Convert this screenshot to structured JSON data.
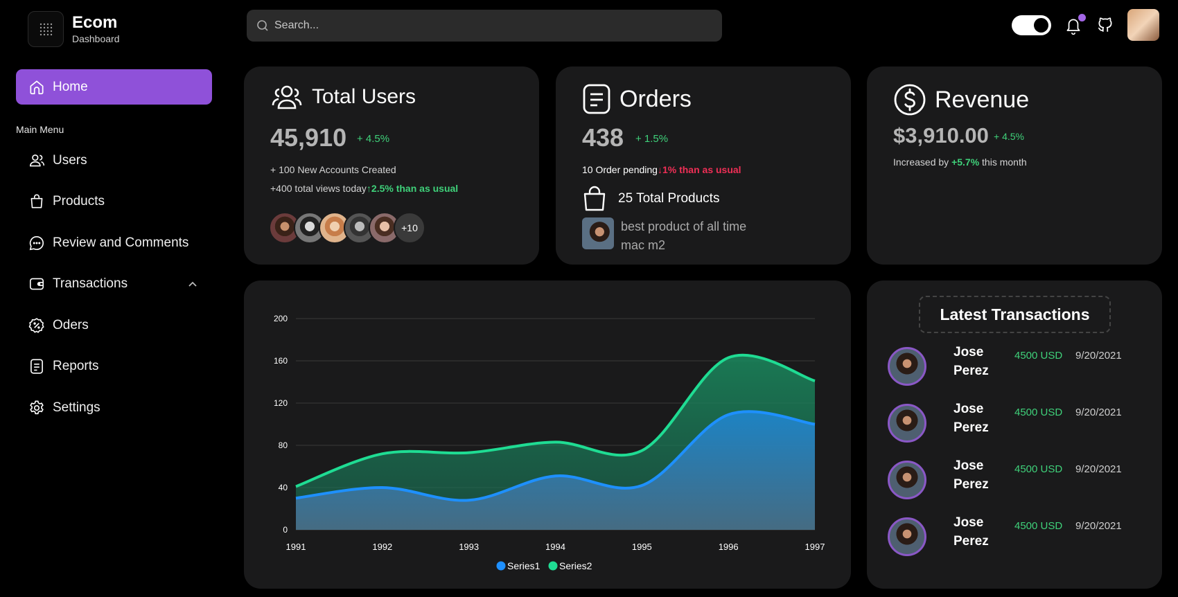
{
  "brand": {
    "title": "Ecom",
    "subtitle": "Dashboard"
  },
  "sidebar": {
    "home_label": "Home",
    "menu_label": "Main Menu",
    "items": [
      {
        "label": "Users",
        "icon": "users-icon"
      },
      {
        "label": "Products",
        "icon": "bag-icon"
      },
      {
        "label": "Review and Comments",
        "icon": "chat-icon"
      },
      {
        "label": "Transactions",
        "icon": "wallet-icon"
      },
      {
        "label": "Oders",
        "icon": "discount-badge-icon"
      },
      {
        "label": "Reports",
        "icon": "report-icon"
      },
      {
        "label": "Settings",
        "icon": "gear-icon"
      }
    ]
  },
  "header": {
    "search_placeholder": "Search...",
    "theme_toggle": "on"
  },
  "cards": {
    "users": {
      "title": "Total Users",
      "value": "45,910",
      "change": "+ 4.5%",
      "line1": "+ 100 New Accounts Created",
      "line2_prefix": "+400 total views today",
      "line2_highlight": "2.5% than as usual",
      "avatars_more": "+10"
    },
    "orders": {
      "title": "Orders",
      "value": "438",
      "change": "+ 1.5%",
      "pending_prefix": "10 Order pending",
      "pending_highlight": "1% than as usual",
      "products_label": "25 Total Products",
      "product_desc": "best product of all time mac m2"
    },
    "revenue": {
      "title": "Revenue",
      "value": "$3,910.00",
      "change": "+ 4.5%",
      "note_prefix": "Increased by",
      "note_highlight": "+5.7%",
      "note_suffix": "this month"
    }
  },
  "chart_data": {
    "type": "area",
    "x": [
      "1991",
      "1992",
      "1993",
      "1994",
      "1995",
      "1996",
      "1997"
    ],
    "series": [
      {
        "name": "Series1",
        "values": [
          30,
          40,
          28,
          51,
          42,
          109,
          100
        ],
        "color": "#1e90ff"
      },
      {
        "name": "Series2",
        "values": [
          41,
          72,
          73,
          83,
          75,
          163,
          141
        ],
        "color": "#1fdc93"
      }
    ],
    "yticks": [
      0,
      40,
      80,
      120,
      160,
      200
    ],
    "ylim": [
      0,
      200
    ],
    "legend": "bottom-center",
    "grid": true
  },
  "transactions": {
    "title": "Latest Transactions",
    "rows": [
      {
        "name": "Jose Perez",
        "amount": "4500 USD",
        "date": "9/20/2021"
      },
      {
        "name": "Jose Perez",
        "amount": "4500 USD",
        "date": "9/20/2021"
      },
      {
        "name": "Jose Perez",
        "amount": "4500 USD",
        "date": "9/20/2021"
      },
      {
        "name": "Jose Perez",
        "amount": "4500 USD",
        "date": "9/20/2021"
      }
    ]
  },
  "colors": {
    "accent": "#8f51d9",
    "positive": "#3fd17a",
    "negative": "#ef2f56",
    "card": "#1a1a1b"
  }
}
